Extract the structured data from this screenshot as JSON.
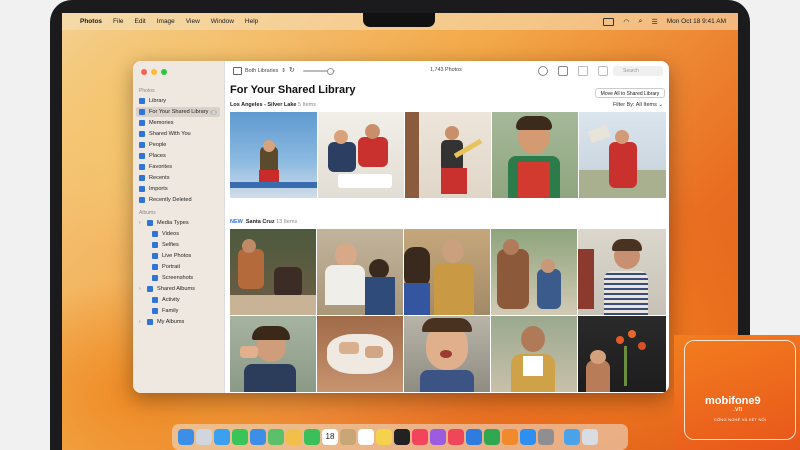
{
  "menubar": {
    "app": "Photos",
    "items": [
      "File",
      "Edit",
      "Image",
      "View",
      "Window",
      "Help"
    ],
    "datetime": "Mon Oct 18  9:41 AM"
  },
  "sidebar": {
    "photos_section": "Photos",
    "items": [
      {
        "label": "Library",
        "icon": "photo-library-icon"
      },
      {
        "label": "For Your Shared Library",
        "icon": "people-icon",
        "badge": "8"
      },
      {
        "label": "Memories",
        "icon": "memories-icon"
      },
      {
        "label": "Shared With You",
        "icon": "shared-with-you-icon"
      },
      {
        "label": "People",
        "icon": "person-icon"
      },
      {
        "label": "Places",
        "icon": "map-pin-icon"
      },
      {
        "label": "Favorites",
        "icon": "heart-icon"
      },
      {
        "label": "Recents",
        "icon": "clock-icon"
      },
      {
        "label": "Imports",
        "icon": "import-icon"
      },
      {
        "label": "Recently Deleted",
        "icon": "trash-icon"
      }
    ],
    "albums_section": "Albums",
    "albums": [
      {
        "label": "Media Types",
        "icon": "folder-icon",
        "expandable": true
      },
      {
        "label": "Videos",
        "icon": "video-icon"
      },
      {
        "label": "Selfies",
        "icon": "selfie-icon"
      },
      {
        "label": "Live Photos",
        "icon": "live-photo-icon"
      },
      {
        "label": "Portrait",
        "icon": "portrait-icon"
      },
      {
        "label": "Screenshots",
        "icon": "screenshot-icon"
      },
      {
        "label": "Shared Albums",
        "icon": "shared-album-icon",
        "expandable": true
      },
      {
        "label": "Activity",
        "icon": "activity-icon"
      },
      {
        "label": "Family",
        "icon": "family-album-icon"
      },
      {
        "label": "My Albums",
        "icon": "folder-icon",
        "expandable": true
      }
    ]
  },
  "toolbar": {
    "library_picker": "Both Libraries",
    "photo_count": "1,743 Photos",
    "search_placeholder": "Search"
  },
  "main": {
    "title": "For Your Shared Library",
    "move_button": "Move All to Shared Library",
    "filter": "Filter By: All Items",
    "section1": {
      "title": "Los Angeles - Silver Lake",
      "count": "5 Items"
    },
    "section2": {
      "badge": "NEW",
      "title": "Santa Cruz",
      "count": "13 Items"
    }
  },
  "dock": {
    "apps": [
      "finder",
      "launchpad",
      "safari",
      "messages",
      "mail",
      "maps",
      "photos",
      "facetime",
      "calendar",
      "contacts",
      "reminders",
      "notes",
      "tv",
      "music",
      "podcasts",
      "news",
      "keynote",
      "numbers",
      "pages",
      "app-store",
      "system-preferences",
      "downloads",
      "trash"
    ],
    "calendar_day": "18"
  },
  "watermark": {
    "brand": "mobifone9",
    "domain": ".vn",
    "tagline": "CÔNG NGHỆ VÀ KẾT NỐI"
  }
}
